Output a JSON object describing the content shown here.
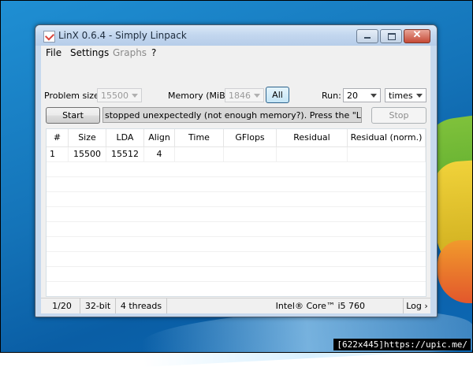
{
  "window": {
    "title": "LinX 0.6.4 - Simply Linpack",
    "close_glyph": "✕"
  },
  "menu": [
    "File",
    "Settings",
    "Graphs",
    "?"
  ],
  "controls": {
    "problem_size_label": "Problem size:",
    "problem_size_value": "15500",
    "memory_label": "Memory (MiB):",
    "memory_value": "1846",
    "all_button": "All",
    "run_label": "Run:",
    "run_value": "20",
    "run_unit": "times",
    "start_button": "Start",
    "stop_button": "Stop",
    "status_message": "stopped unexpectedly (not enough memory?). Press the \"Log >\" button"
  },
  "table": {
    "columns": [
      "#",
      "Size",
      "LDA",
      "Align",
      "Time",
      "GFlops",
      "Residual",
      "Residual (norm.)"
    ],
    "rows": [
      [
        "1",
        "15500",
        "15512",
        "4",
        "",
        "",
        "",
        ""
      ]
    ]
  },
  "statusbar": {
    "progress": "1/20",
    "arch": "32-bit",
    "threads": "4 threads",
    "cpu": "Intel® Core™ i5 760",
    "log": "Log ›"
  },
  "watermark": "[622x445]https://upic.me/",
  "colors": {
    "desktop_blue": "#1473b8",
    "window_frame": "#c7d9ee",
    "close_red": "#c54a36"
  }
}
